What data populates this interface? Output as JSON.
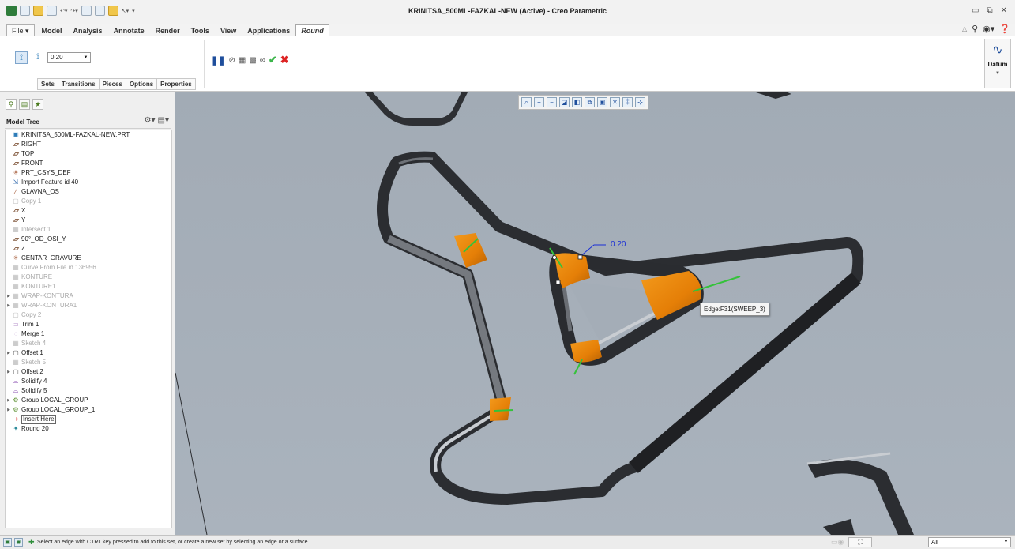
{
  "window": {
    "title": "KRINITSA_500ML-FAZKAL-NEW (Active) - Creo Parametric"
  },
  "ribbon": {
    "tabs": [
      "File",
      "Model",
      "Analysis",
      "Annotate",
      "Render",
      "Tools",
      "View",
      "Applications",
      "Round"
    ],
    "active_tab": "Round",
    "radius_value": "0.20",
    "subtabs": [
      "Sets",
      "Transitions",
      "Pieces",
      "Options",
      "Properties"
    ],
    "datum_label": "Datum"
  },
  "model_tree": {
    "header": "Model Tree",
    "items": [
      {
        "label": "KRINITSA_500ML-FAZKAL-NEW.PRT",
        "icon": "part-icon"
      },
      {
        "label": "RIGHT",
        "icon": "datum-plane-icon"
      },
      {
        "label": "TOP",
        "icon": "datum-plane-icon"
      },
      {
        "label": "FRONT",
        "icon": "datum-plane-icon"
      },
      {
        "label": "PRT_CSYS_DEF",
        "icon": "csys-icon"
      },
      {
        "label": "Import Feature id 40",
        "icon": "import-icon"
      },
      {
        "label": "GLAVNA_OS",
        "icon": "axis-icon"
      },
      {
        "label": "Copy 1",
        "icon": "copy-icon"
      },
      {
        "label": "X",
        "icon": "datum-plane-icon"
      },
      {
        "label": "Y",
        "icon": "datum-plane-icon"
      },
      {
        "label": "Intersect 1",
        "icon": "intersect-icon"
      },
      {
        "label": "90°_OD_OSI_Y",
        "icon": "datum-plane-icon"
      },
      {
        "label": "Z",
        "icon": "datum-plane-icon"
      },
      {
        "label": "CENTAR_GRAVURE",
        "icon": "csys-icon"
      },
      {
        "label": "Curve From File id 136956",
        "icon": "curve-icon"
      },
      {
        "label": "KONTURE",
        "icon": "sketch-icon"
      },
      {
        "label": "KONTURE1",
        "icon": "sketch-icon"
      },
      {
        "label": "WRAP-KONTURA",
        "icon": "wrap-icon"
      },
      {
        "label": "WRAP-KONTURA1",
        "icon": "wrap-icon"
      },
      {
        "label": "Copy 2",
        "icon": "copy-icon"
      },
      {
        "label": "Trim 1",
        "icon": "trim-icon"
      },
      {
        "label": "Merge 1",
        "icon": "merge-icon"
      },
      {
        "label": "Sketch 4",
        "icon": "sketch-icon"
      },
      {
        "label": "Offset 1",
        "icon": "offset-icon"
      },
      {
        "label": "Sketch 5",
        "icon": "sketch-icon"
      },
      {
        "label": "Offset 2",
        "icon": "offset-icon"
      },
      {
        "label": "Solidify 4",
        "icon": "solidify-icon"
      },
      {
        "label": "Solidify 5",
        "icon": "solidify-icon"
      },
      {
        "label": "Group LOCAL_GROUP",
        "icon": "group-icon"
      },
      {
        "label": "Group LOCAL_GROUP_1",
        "icon": "group-icon"
      },
      {
        "label": "Insert Here",
        "icon": "insert-arrow-icon"
      },
      {
        "label": "Round 20",
        "icon": "round-icon"
      }
    ]
  },
  "viewport": {
    "dimension_value": "0.20",
    "edge_tooltip": "Edge:F31(SWEEP_3)"
  },
  "status": {
    "message": "Select an edge with CTRL key pressed to add to this set, or create a new set by selecting an edge or a surface.",
    "filter_value": "All"
  }
}
